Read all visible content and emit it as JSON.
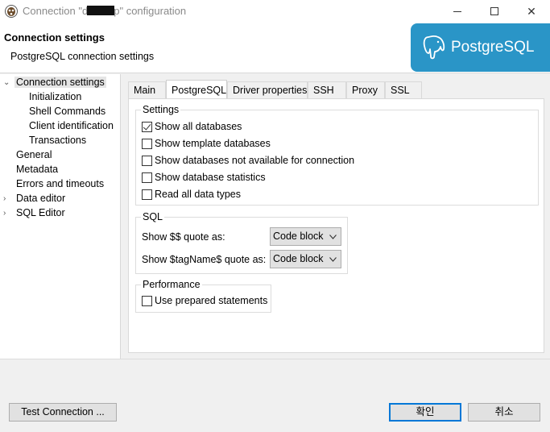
{
  "window": {
    "title_prefix": "Connection \"d",
    "title_suffix": "p\" configuration",
    "minimize_glyph": "",
    "maximize_glyph": "",
    "close_glyph": "✕"
  },
  "header": {
    "title": "Connection settings",
    "subtitle": "PostgreSQL connection settings",
    "logo_text": "PostgreSQL"
  },
  "nav": {
    "items": [
      {
        "label": "Connection settings",
        "expanded": true,
        "selected": true
      },
      {
        "label": "Initialization"
      },
      {
        "label": "Shell Commands"
      },
      {
        "label": "Client identification"
      },
      {
        "label": "Transactions"
      },
      {
        "label": "General"
      },
      {
        "label": "Metadata"
      },
      {
        "label": "Errors and timeouts"
      },
      {
        "label": "Data editor",
        "expandable": true
      },
      {
        "label": "SQL Editor",
        "expandable": true
      }
    ]
  },
  "tabs": [
    {
      "label": "Main"
    },
    {
      "label": "PostgreSQL",
      "active": true
    },
    {
      "label": "Driver properties"
    },
    {
      "label": "SSH"
    },
    {
      "label": "Proxy"
    },
    {
      "label": "SSL"
    }
  ],
  "settings_group": {
    "label": "Settings",
    "options": [
      {
        "label": "Show all databases",
        "checked": true
      },
      {
        "label": "Show template databases",
        "checked": false
      },
      {
        "label": "Show databases not available for connection",
        "checked": false
      },
      {
        "label": "Show database statistics",
        "checked": false
      },
      {
        "label": "Read all data types",
        "checked": false
      }
    ]
  },
  "sql_group": {
    "label": "SQL",
    "dollar_quote_label": "Show $$ quote as:",
    "dollar_quote_value": "Code block",
    "tagname_quote_label": "Show $tagName$ quote as:",
    "tagname_quote_value": "Code block"
  },
  "performance_group": {
    "label": "Performance",
    "use_prepared_statements": {
      "label": "Use prepared statements",
      "checked": false
    }
  },
  "buttons": {
    "test_connection": "Test Connection ...",
    "ok": "확인",
    "cancel": "취소"
  },
  "colors": {
    "logo_bg": "#2a95c7",
    "default_button_border": "#0078d7"
  }
}
